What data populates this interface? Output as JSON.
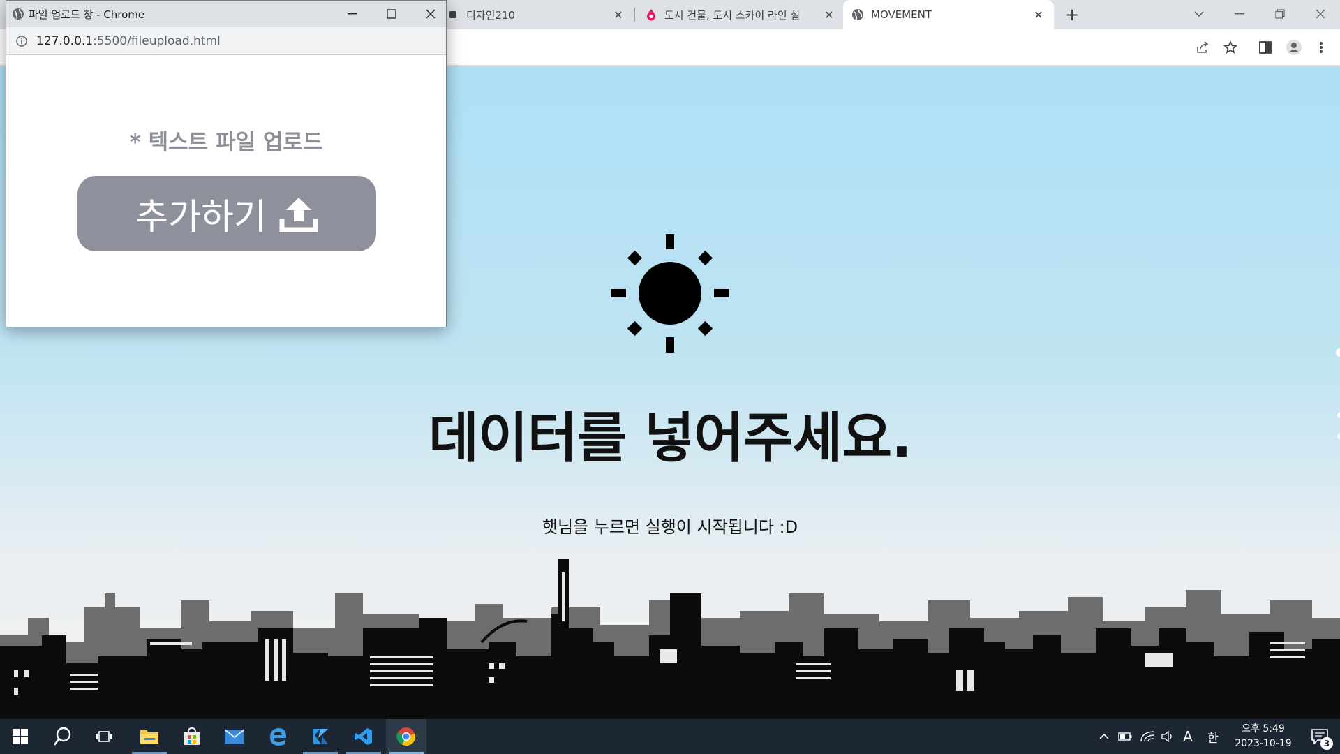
{
  "browser": {
    "tabs": [
      {
        "title": "디자인210",
        "favicon": "dark-square-icon",
        "active": false
      },
      {
        "title": "도시 건물, 도시 스카이 라인 실",
        "favicon": "pink-drop-icon",
        "active": false
      },
      {
        "title": "MOVEMENT",
        "favicon": "globe-icon",
        "active": true
      }
    ],
    "new_tab_label": "+",
    "toolbar_icons": [
      "share-icon",
      "star-icon",
      "side-panel-icon",
      "profile-icon",
      "menu-icon"
    ]
  },
  "page": {
    "headline": "데이터를 넣어주세요.",
    "subtext": "햇님을 누르면 실행이 시작됩니다 :D",
    "sun_icon": "sun-icon"
  },
  "popup": {
    "title": "파일 업로드 창 - Chrome",
    "url_host": "127.0.0.1",
    "url_path": ":5500/fileupload.html",
    "upload_label": "* 텍스트 파일 업로드",
    "upload_button": "추가하기",
    "upload_icon": "upload-icon"
  },
  "taskbar": {
    "apps": [
      "start-icon",
      "search-icon",
      "task-view-icon",
      "file-explorer-icon",
      "store-icon",
      "mail-icon",
      "edge-legacy-icon",
      "kotlin-icon",
      "vscode-icon",
      "chrome-icon"
    ],
    "tray": {
      "ime_mode": "A",
      "ime_lang": "한",
      "time": "오후 5:49",
      "date": "2023-10-19",
      "notification_count": "3"
    }
  },
  "colors": {
    "sky_top": "#ade0f6",
    "button_gray": "#8e909c",
    "label_gray": "#8c8f99",
    "taskbar": "#1c2733"
  }
}
